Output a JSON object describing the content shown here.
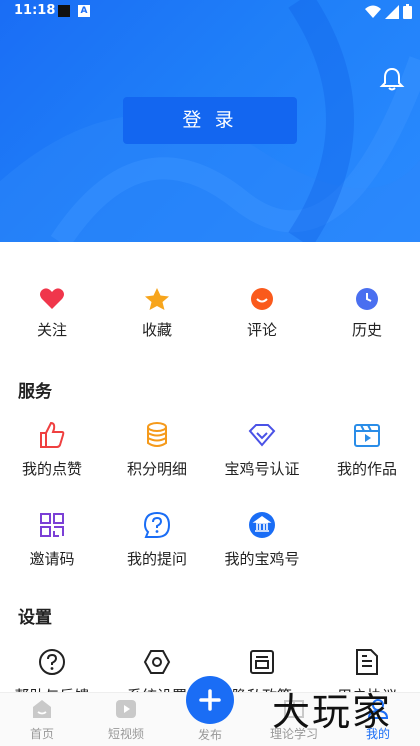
{
  "status_bar": {
    "time": "11:18",
    "badge_letter": "A"
  },
  "header": {
    "login_label": "登 录",
    "bell_icon": "bell-icon"
  },
  "quick_actions": [
    {
      "label": "关注",
      "icon": "heart-icon",
      "color": "#f0364b"
    },
    {
      "label": "收藏",
      "icon": "star-icon",
      "color": "#f7a51c"
    },
    {
      "label": "评论",
      "icon": "comment-icon",
      "color": "#fa5a1c"
    },
    {
      "label": "历史",
      "icon": "clock-icon",
      "color": "#4a6ff0"
    }
  ],
  "services": {
    "title": "服务",
    "items": [
      {
        "label": "我的点赞",
        "icon": "thumbs-up-icon",
        "color": "#ef4040"
      },
      {
        "label": "积分明细",
        "icon": "coins-icon",
        "color": "#f59a1b"
      },
      {
        "label": "宝鸡号认证",
        "icon": "diamond-icon",
        "color": "#4a52e6"
      },
      {
        "label": "我的作品",
        "icon": "video-icon",
        "color": "#2a8de8"
      },
      {
        "label": "邀请码",
        "icon": "qr-code-icon",
        "color": "#7b3fd6"
      },
      {
        "label": "我的提问",
        "icon": "question-icon",
        "color": "#1a6df5"
      },
      {
        "label": "我的宝鸡号",
        "icon": "bank-icon",
        "color": "#1a6df5"
      }
    ]
  },
  "settings": {
    "title": "设置",
    "items": [
      {
        "label": "帮助与反馈",
        "icon": "help-icon"
      },
      {
        "label": "系统设置",
        "icon": "hexagon-settings-icon"
      },
      {
        "label": "隐私政策",
        "icon": "policy-icon"
      },
      {
        "label": "用户协议",
        "icon": "document-icon"
      }
    ]
  },
  "bottom_nav": [
    {
      "label": "首页",
      "icon": "home-icon"
    },
    {
      "label": "短视频",
      "icon": "play-icon"
    },
    {
      "label": "发布",
      "icon": "plus-icon"
    },
    {
      "label": "理论学习",
      "icon": "study-icon"
    },
    {
      "label": "我的",
      "icon": "user-icon",
      "active": true
    }
  ],
  "watermark": "大玩家",
  "colors": {
    "accent": "#1a6df5",
    "header_bg": "#1f7ff8"
  }
}
